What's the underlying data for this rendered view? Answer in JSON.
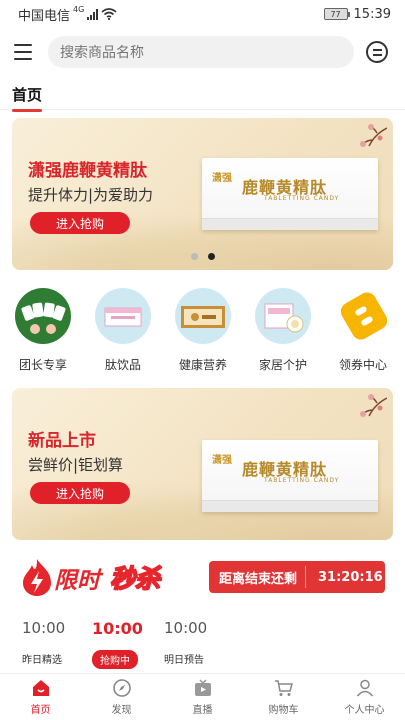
{
  "status": {
    "carrier": "中国电信",
    "network": "4G",
    "battery": "77",
    "time": "15:39"
  },
  "header": {
    "search_placeholder": "搜索商品名称"
  },
  "tabs": [
    {
      "label": "首页"
    }
  ],
  "banner1": {
    "title": "潇强鹿鞭黄精肽",
    "subtitle": "提升体力|为爱助力",
    "cta": "进入抢购",
    "product_logo": "潇强",
    "product_name": "鹿鞭黄精肽",
    "product_sub": "TABLETTING CANDY"
  },
  "categories": [
    {
      "label": "团长专享",
      "color": "#2e7d32"
    },
    {
      "label": "肽饮品",
      "color": "#cfe9f2"
    },
    {
      "label": "健康营养",
      "color": "#cfe9f2"
    },
    {
      "label": "家居个护",
      "color": "#cfe9f2"
    },
    {
      "label": "领券中心",
      "color": "#f7b500"
    }
  ],
  "banner2": {
    "title": "新品上市",
    "subtitle": "尝鲜价|钜划算",
    "cta": "进入抢购",
    "product_logo": "潇强",
    "product_name": "鹿鞭黄精肽",
    "product_sub": "TABLETTING CANDY"
  },
  "flash": {
    "logo_a": "限时",
    "logo_b": "秒杀",
    "countdown_label": "距离结束还剩",
    "countdown_time": "31:20:16",
    "slots": [
      {
        "time": "10:00",
        "tag": "昨日精选"
      },
      {
        "time": "10:00",
        "tag": "抢购中"
      },
      {
        "time": "10:00",
        "tag": "明日预告"
      }
    ]
  },
  "nav": [
    {
      "label": "首页",
      "icon": "home-icon"
    },
    {
      "label": "发现",
      "icon": "compass-icon"
    },
    {
      "label": "直播",
      "icon": "tv-icon"
    },
    {
      "label": "购物车",
      "icon": "cart-icon"
    },
    {
      "label": "个人中心",
      "icon": "user-icon"
    }
  ]
}
